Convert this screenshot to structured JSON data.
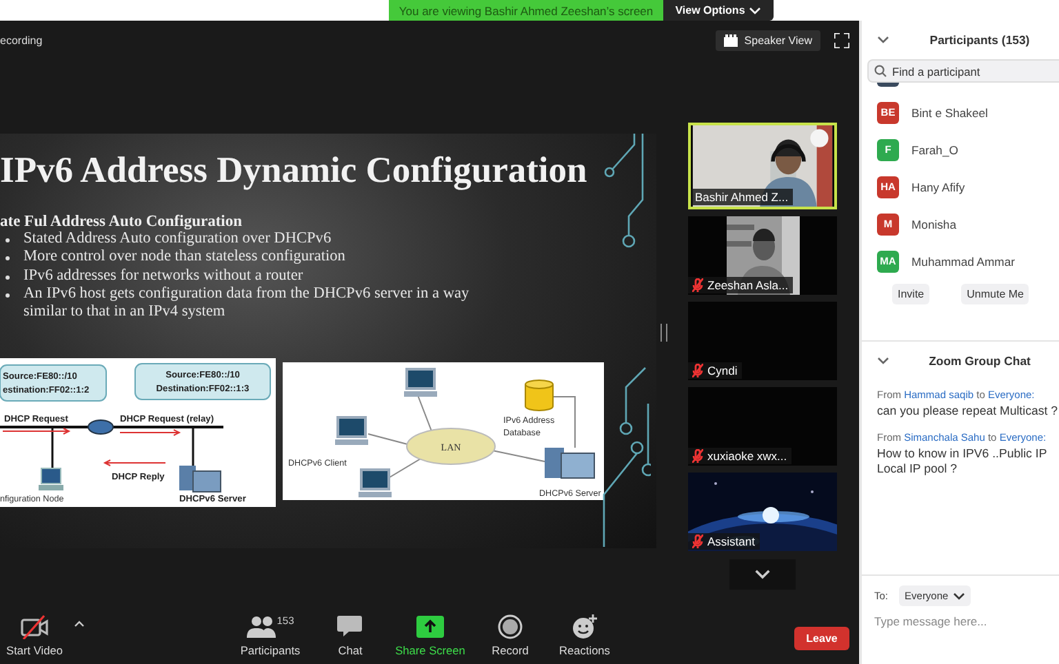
{
  "banner": {
    "message": "You are viewing Bashir Ahmed Zeeshan’s screen",
    "options_button": "View Options"
  },
  "meeting_header": {
    "recording_label": "ecording",
    "view_button": "Speaker View"
  },
  "slide": {
    "title": "IPv6 Address Dynamic Configuration",
    "heading": "ate Ful Address Auto Configuration",
    "bullets": [
      "Stated Address Auto configuration over DHCPv6",
      "More control over node than stateless configuration",
      "IPv6 addresses for networks without a router",
      "An IPv6 host gets configuration data from the DHCPv6 server in a way similar to that in an IPv4 system"
    ]
  },
  "relay_diagram": {
    "boxes": [
      {
        "lines": [
          "Source:FE80::/10",
          "estination:FF02::1:2"
        ]
      },
      {
        "lines": [
          "Source:FE80::/10",
          "Destination:FF02::1:3"
        ]
      }
    ],
    "request_label": "DHCP Request",
    "relay_label": "DHCP Request (relay)",
    "reply_label": "DHCP Reply",
    "node_label": "nfiguration Node",
    "server_label": "DHCPv6 Server"
  },
  "lan_diagram": {
    "client_label": "DHCPv6  Client",
    "lan_label": "LAN",
    "database_label": [
      "IPv6 Address",
      "Database"
    ],
    "server_label": "DHCPv6 Server"
  },
  "video_tiles": [
    {
      "kind": "camera",
      "name": "Bashir Ahmed Z...",
      "muted": false,
      "active": true
    },
    {
      "name": "Zeeshan Asla...",
      "muted": true,
      "active": false
    },
    {
      "kind": "blank",
      "name": "Cyndi",
      "muted": true,
      "active": false
    },
    {
      "kind": "blank",
      "name": "xuxiaoke xwx...",
      "muted": true,
      "active": false
    },
    {
      "kind": "picture",
      "name": "Assistant",
      "muted": true,
      "active": false
    }
  ],
  "toolbar": {
    "items": [
      {
        "kind": "video",
        "label": "Start Video"
      },
      {
        "kind": "participants",
        "label": "Participants",
        "count": "153"
      },
      {
        "kind": "chat",
        "label": "Chat"
      },
      {
        "kind": "share",
        "label": "Share Screen"
      },
      {
        "kind": "record",
        "label": "Record"
      },
      {
        "kind": "reactions",
        "label": "Reactions"
      }
    ],
    "leave_button": "Leave"
  },
  "participants": {
    "title": "Participants (153)",
    "search": {
      "placeholder": "Find a participant"
    },
    "items": [
      {
        "initials": "BE",
        "name": "Bint e Shakeel",
        "color": "#c8382c"
      },
      {
        "initials": "F",
        "name": "Farah_O",
        "color": "#2eaa4f"
      },
      {
        "initials": "HA",
        "name": "Hany Afify",
        "color": "#c8382c"
      },
      {
        "initials": "M",
        "name": "Monisha",
        "color": "#c8382c"
      },
      {
        "initials": "MA",
        "name": "Muhammad Ammar",
        "color": "#2eaa4f"
      }
    ],
    "buttons": [
      "Invite",
      "Unmute Me"
    ]
  },
  "chat": {
    "title": "Zoom Group Chat",
    "messages": [
      {
        "from_word": "From",
        "sender": "Hammad saqib",
        "to_word": "to",
        "recipient": "Everyone:",
        "lines": [
          "can you please repeat Multicast ?"
        ]
      },
      {
        "from_word": "From",
        "sender": "Simanchala Sahu",
        "to_word": "to",
        "recipient": "Everyone:",
        "lines": [
          "How to know in IPV6 ..Public IP",
          "Local IP pool ?"
        ]
      }
    ],
    "to_label": "To:",
    "recipient_button": "Everyone",
    "input": {
      "placeholder": "Type message here..."
    }
  }
}
